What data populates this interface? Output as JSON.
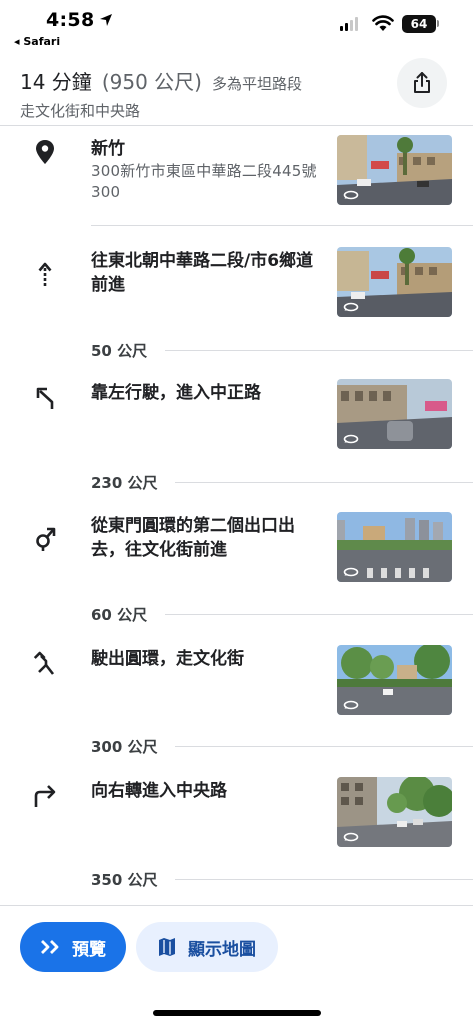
{
  "status_bar": {
    "time": "4:58",
    "back_app": "◂ Safari",
    "battery": "64"
  },
  "header": {
    "duration": "14 分鐘",
    "distance": "(950 公尺)",
    "flat_note": "多為平坦路段",
    "via": "走文化街和中央路"
  },
  "steps": [
    {
      "icon": "location-pin-icon",
      "title": "新竹",
      "subtitle": "300新竹市東區中華路二段445號300"
    },
    {
      "icon": "straight-arrow-icon",
      "title": "往東北朝中華路二段/市6鄉道前進",
      "distance": "50 公尺"
    },
    {
      "icon": "keep-left-icon",
      "title": "靠左行駛，進入中正路",
      "distance": "230 公尺"
    },
    {
      "icon": "roundabout-icon",
      "title": "從東門圓環的第二個出口出去，往文化街前進",
      "distance": "60 公尺"
    },
    {
      "icon": "roundabout-exit-icon",
      "title": "駛出圓環，走文化街",
      "distance": "300 公尺"
    },
    {
      "icon": "turn-right-icon",
      "title": "向右轉進入中央路",
      "distance": "350 公尺"
    }
  ],
  "bottom": {
    "preview_label": "預覽",
    "map_label": "顯示地圖"
  },
  "colors": {
    "accent": "#1a73e8",
    "map_button_bg": "#e8f0fe"
  }
}
